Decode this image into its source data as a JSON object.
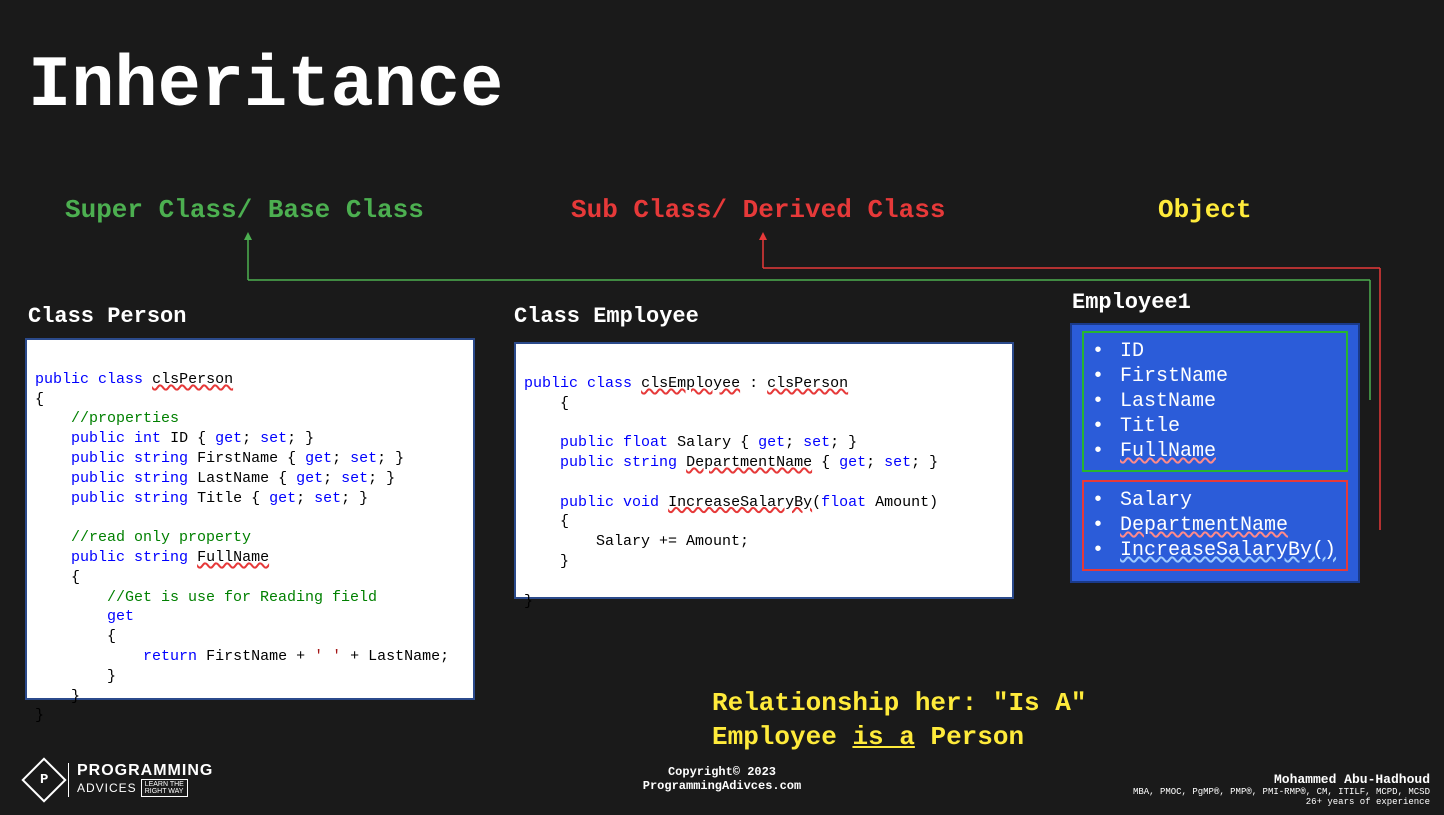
{
  "title": "Inheritance",
  "headers": {
    "super": "Super Class/ Base Class",
    "sub": "Sub Class/ Derived Class",
    "object": "Object"
  },
  "classPersonLabel": "Class Person",
  "classEmployeeLabel": "Class Employee",
  "codePerson": {
    "l1a": "public",
    "l1b": "class",
    "l1c": "clsPerson",
    "brace_open": "{",
    "c1": "//properties",
    "p": "public",
    "t_int": "int",
    "t_str": "string",
    "id": "ID",
    "fn": "FirstName",
    "ln": "LastName",
    "ti": "Title",
    "get": "get",
    "set": "set",
    "c2": "//read only property",
    "full": "FullName",
    "c3": "//Get is use for Reading field",
    "ret": "return",
    "plus": " + ",
    "space_lit": "' '",
    "semi": ";",
    "brace_close": "}"
  },
  "codeEmployee": {
    "p": "public",
    "cls": "class",
    "emp": "clsEmployee",
    "colon": " : ",
    "per": "clsPerson",
    "t_float": "float",
    "t_str": "string",
    "t_void": "void",
    "sal": "Salary",
    "dn": "DepartmentName",
    "inc": "IncreaseSalaryBy",
    "amt": "Amount",
    "get": "get",
    "set": "set",
    "body": "Salary += Amount;"
  },
  "object": {
    "title": "Employee1",
    "group1": [
      "ID",
      "FirstName",
      "LastName",
      "Title",
      "FullName"
    ],
    "group2": [
      "Salary",
      "DepartmentName",
      "IncreaseSalaryBy()"
    ]
  },
  "relationship": {
    "line1": "Relationship her: \"Is A\"",
    "line2a": "Employee ",
    "line2b": "is a",
    "line2c": " Person"
  },
  "footer": {
    "copy": "Copyright© 2023",
    "site": "ProgrammingAdivces.com",
    "author": "Mohammed Abu-Hadhoud",
    "creds": "MBA, PMOC, PgMP®, PMP®, PMI-RMP®, CM, ITILF, MCPD, MCSD",
    "exp": "26+ years of experience"
  },
  "logo": {
    "main": "PROGRAMMING",
    "sub": "ADVICES",
    "tag": "LEARN THE\nRIGHT WAY"
  }
}
